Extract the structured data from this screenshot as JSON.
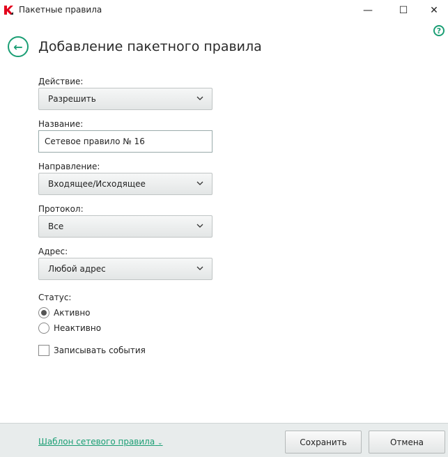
{
  "window": {
    "title": "Пакетные правила",
    "minimize": "—",
    "maximize": "☐",
    "close": "✕"
  },
  "page": {
    "title": "Добавление пакетного правила",
    "help": "?",
    "back": "←"
  },
  "form": {
    "action": {
      "label": "Действие:",
      "value": "Разрешить"
    },
    "name": {
      "label": "Название:",
      "value": "Сетевое правило № 16"
    },
    "direction": {
      "label": "Направление:",
      "value": "Входящее/Исходящее"
    },
    "protocol": {
      "label": "Протокол:",
      "value": "Все"
    },
    "address": {
      "label": "Адрес:",
      "value": "Любой адрес"
    },
    "status": {
      "label": "Статус:",
      "options": [
        "Активно",
        "Неактивно"
      ],
      "selected": "Активно"
    },
    "log_events": {
      "label": "Записывать события",
      "checked": false
    }
  },
  "footer": {
    "template_link": "Шаблон сетевого правила",
    "save": "Сохранить",
    "cancel": "Отмена"
  },
  "colors": {
    "accent": "#1a9e74",
    "logo": "#e3001b"
  }
}
